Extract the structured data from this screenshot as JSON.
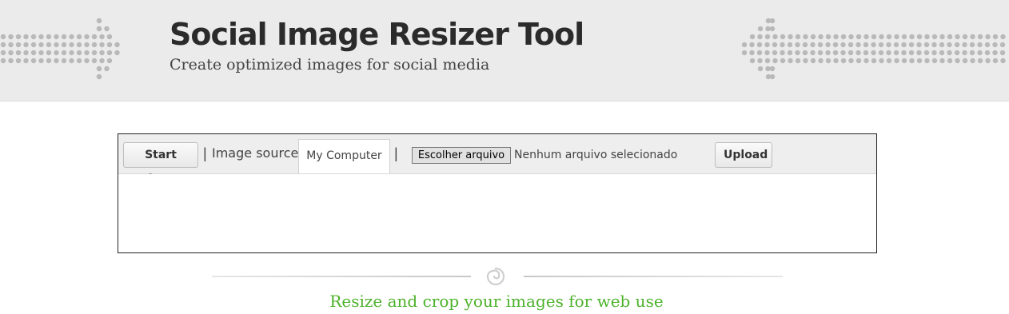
{
  "header": {
    "title": "Social Image Resizer Tool",
    "subtitle": "Create optimized images for social media",
    "background_color": "#ebebeb",
    "dot_color": "#b9b9b9"
  },
  "toolbar": {
    "start_over_label": "Start Over",
    "separator": "|",
    "image_source_label": "Image source:",
    "source_tab_label": "My Computer",
    "file_button_label": "Escolher arquivo",
    "file_status": "Nenhum arquivo selecionado",
    "upload_label": "Upload"
  },
  "footer": {
    "tagline": "Resize and crop your images for web use",
    "tagline_color": "#4cb22a",
    "divider_icon": "swirl-icon"
  }
}
